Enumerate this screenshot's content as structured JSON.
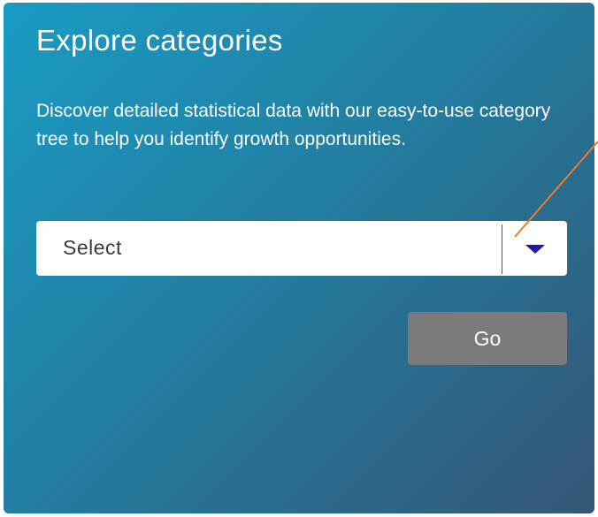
{
  "widget": {
    "title": "Explore categories",
    "description": "Discover detailed statistical data with our easy-to-use category tree to help you identify growth opportunities.",
    "select": {
      "value": "Select"
    },
    "go_label": "Go"
  },
  "colors": {
    "panel_gradient_start": "#1a9bc4",
    "panel_gradient_end": "#355674",
    "dropdown_arrow": "#1a1aa6",
    "go_button": "#7b7b7b",
    "annotation_line": "#f07a28"
  },
  "icons": {
    "dropdown": "chevron-down-icon"
  }
}
